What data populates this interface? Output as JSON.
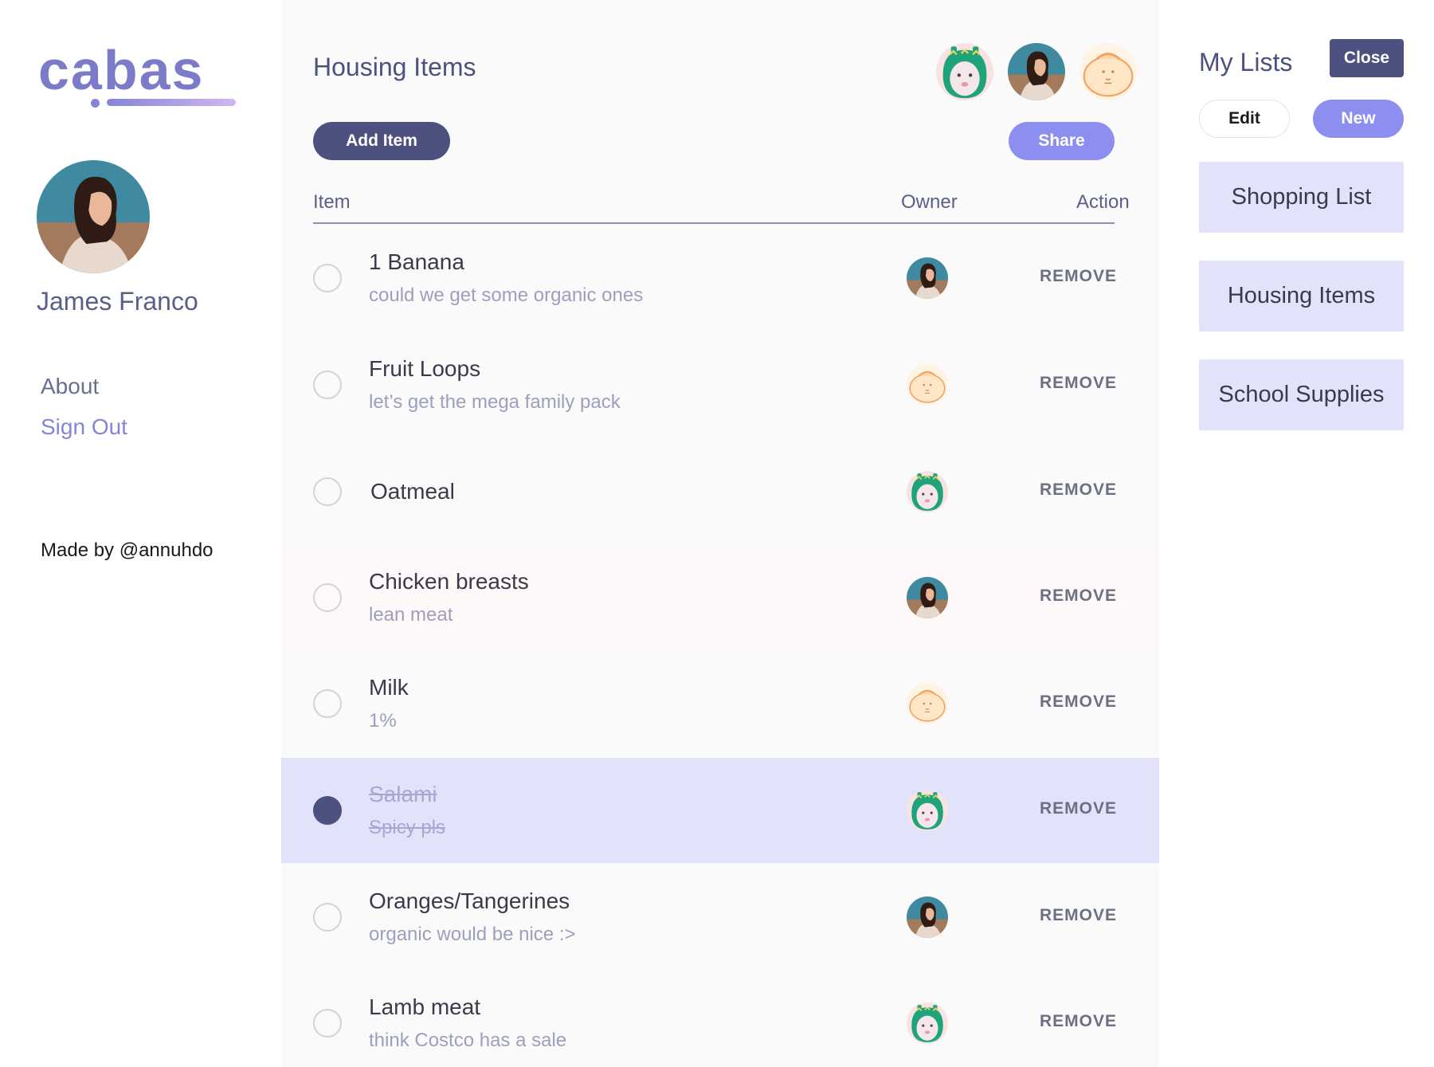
{
  "app": {
    "logo_text": "cabas",
    "brand_color": "#7b7bc9",
    "accent_color": "#8c8ef0",
    "dark_color": "#4c5180"
  },
  "sidebar": {
    "user_name": "James Franco",
    "avatar_icon": "user-photo-icon",
    "nav": [
      {
        "label": "About"
      },
      {
        "label": "Sign Out"
      }
    ],
    "footer": "Made by @annuhdo"
  },
  "main": {
    "title": "Housing Items",
    "add_button": "Add Item",
    "share_button": "Share",
    "columns": {
      "item": "Item",
      "owner": "Owner",
      "action": "Action"
    },
    "collaborators": [
      {
        "icon": "green-hat-avatar-icon"
      },
      {
        "icon": "user-photo-icon"
      },
      {
        "icon": "bun-avatar-icon"
      }
    ],
    "items": [
      {
        "name": "1 Banana",
        "note": "could we get some organic ones",
        "owner": "photo",
        "checked": false,
        "action": "REMOVE"
      },
      {
        "name": "Fruit Loops",
        "note": "let’s get the mega family pack",
        "owner": "bun",
        "checked": false,
        "action": "REMOVE"
      },
      {
        "name": "Oatmeal",
        "note": "",
        "owner": "green",
        "checked": false,
        "action": "REMOVE"
      },
      {
        "name": "Chicken breasts",
        "note": "lean meat",
        "owner": "photo",
        "checked": false,
        "action": "REMOVE"
      },
      {
        "name": "Milk",
        "note": "1%",
        "owner": "bun",
        "checked": false,
        "action": "REMOVE"
      },
      {
        "name": "Salami",
        "note": "Spicy pls",
        "owner": "green",
        "checked": true,
        "action": "REMOVE"
      },
      {
        "name": "Oranges/Tangerines",
        "note": "organic would be nice :>",
        "owner": "photo",
        "checked": false,
        "action": "REMOVE"
      },
      {
        "name": "Lamb meat",
        "note": "think Costco has a sale",
        "owner": "green",
        "checked": false,
        "action": "REMOVE"
      }
    ]
  },
  "lists_panel": {
    "title": "My Lists",
    "close_button": "Close",
    "edit_button": "Edit",
    "new_button": "New",
    "lists": [
      {
        "label": "Shopping List"
      },
      {
        "label": "Housing Items"
      },
      {
        "label": "School Supplies"
      }
    ]
  }
}
